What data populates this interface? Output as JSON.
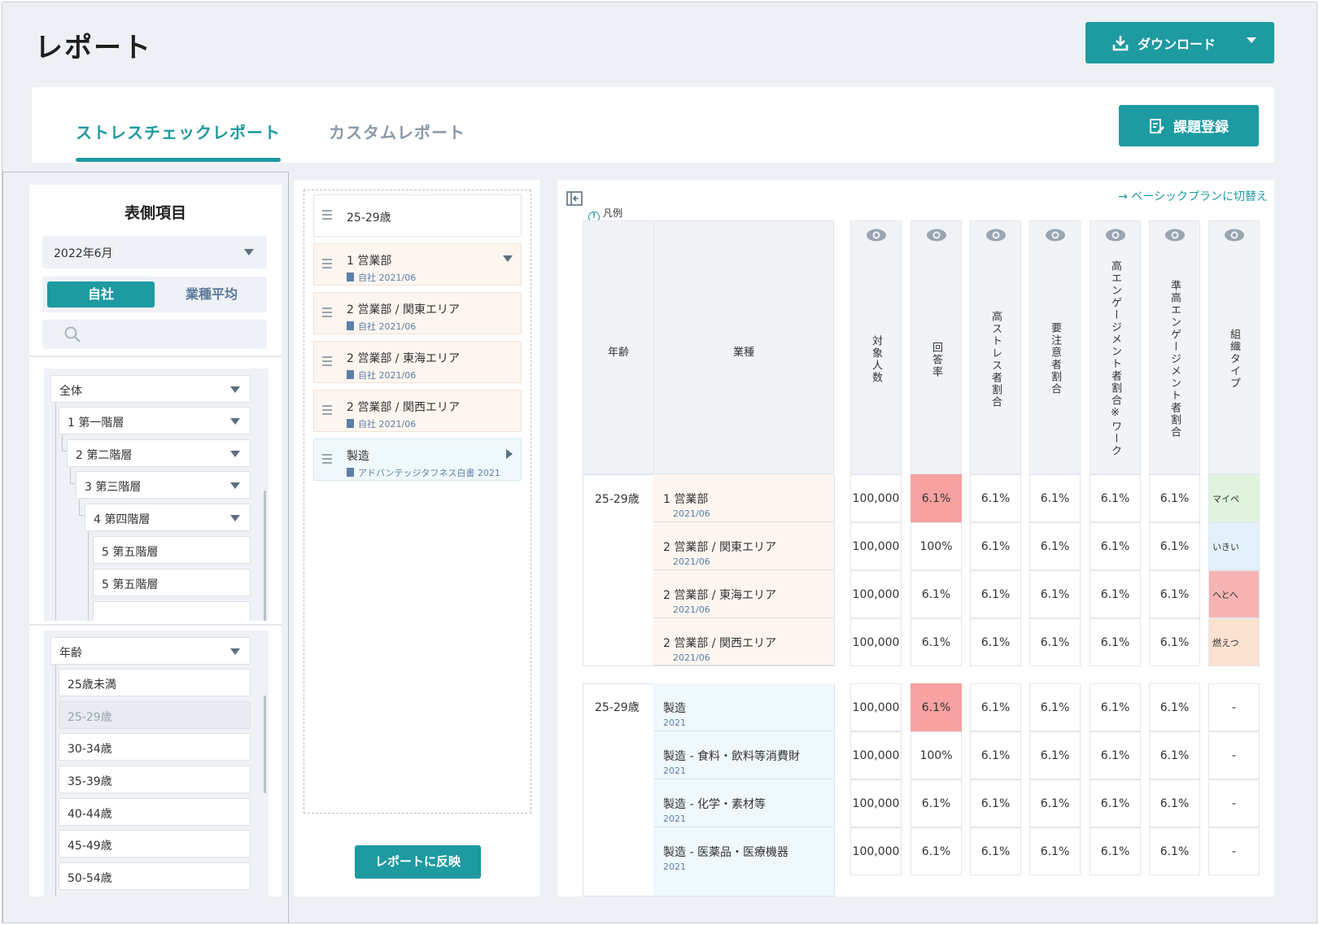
{
  "page": {
    "title": "レポート"
  },
  "header": {
    "download_label": "ダウンロード"
  },
  "tabs": [
    {
      "label": "ストレスチェックレポート",
      "active": true
    },
    {
      "label": "カスタムレポート",
      "active": false
    }
  ],
  "issue_button": "課題登録",
  "left_panel": {
    "title": "表側項目",
    "period": "2022年6月",
    "segment": {
      "on": "自社",
      "off": "業種平均"
    },
    "search_placeholder": "",
    "tree": [
      {
        "label": "全体",
        "level": 0
      },
      {
        "label": "1 第一階層",
        "level": 1
      },
      {
        "label": "2 第二階層",
        "level": 2
      },
      {
        "label": "3 第三階層",
        "level": 3
      },
      {
        "label": "4 第四階層",
        "level": 4
      },
      {
        "label": "5 第五階層",
        "level": 5
      },
      {
        "label": "5 第五階層",
        "level": 5
      }
    ],
    "age": {
      "header": "年齢",
      "items": [
        "25歳未満",
        "25-29歳",
        "30-34歳",
        "35-39歳",
        "40-44歳",
        "45-49歳",
        "50-54歳"
      ]
    }
  },
  "middle_panel": {
    "cards": [
      {
        "l1": "25-29歳",
        "l2": ""
      },
      {
        "l1": "1 営業部",
        "l2": "自社 2021/06"
      },
      {
        "l1": "2 営業部 / 関東エリア",
        "l2": "自社 2021/06"
      },
      {
        "l1": "2 営業部 / 東海エリア",
        "l2": "自社 2021/06"
      },
      {
        "l1": "2 営業部 / 関西エリア",
        "l2": "自社 2021/06"
      },
      {
        "l1": "製造",
        "l2": "アドバンテッジタフネス白書 2021"
      }
    ],
    "reflect_button": "レポートに反映"
  },
  "right_panel": {
    "switch_link": "→ ベーシックプランに切替え",
    "legend": "凡例",
    "columns": {
      "age": "年齢",
      "industry": "業種",
      "c1": "対象人数",
      "c2": "回答率",
      "c3": "高ストレス者割合",
      "c4": "要注意者割合",
      "c5": "高エンゲージメント者割合※ワーク",
      "c6": "準高エンゲージメント者割合",
      "c7": "組織タイプ"
    },
    "group1": {
      "age": "25-29歳",
      "rows": [
        {
          "name": "1 営業部",
          "sub": "2021/06",
          "c1": "100,000",
          "c2": "6.1%",
          "c3": "6.1%",
          "c4": "6.1%",
          "c5": "6.1%",
          "c6": "6.1%",
          "c7": "マイペ"
        },
        {
          "name": "2 営業部 / 関東エリア",
          "sub": "2021/06",
          "c1": "100,000",
          "c2": "100%",
          "c3": "6.1%",
          "c4": "6.1%",
          "c5": "6.1%",
          "c6": "6.1%",
          "c7": "いきい"
        },
        {
          "name": "2 営業部 / 東海エリア",
          "sub": "2021/06",
          "c1": "100,000",
          "c2": "6.1%",
          "c3": "6.1%",
          "c4": "6.1%",
          "c5": "6.1%",
          "c6": "6.1%",
          "c7": "へとへ"
        },
        {
          "name": "2 営業部 / 関西エリア",
          "sub": "2021/06",
          "c1": "100,000",
          "c2": "6.1%",
          "c3": "6.1%",
          "c4": "6.1%",
          "c5": "6.1%",
          "c6": "6.1%",
          "c7": "燃えつ"
        }
      ]
    },
    "group2": {
      "age": "25-29歳",
      "rows": [
        {
          "name": "製造",
          "sub": "2021",
          "c1": "100,000",
          "c2": "6.1%",
          "c3": "6.1%",
          "c4": "6.1%",
          "c5": "6.1%",
          "c6": "6.1%",
          "c7": "-"
        },
        {
          "name": "製造 - 食料・飲料等消費財",
          "sub": "2021",
          "c1": "100,000",
          "c2": "100%",
          "c3": "6.1%",
          "c4": "6.1%",
          "c5": "6.1%",
          "c6": "6.1%",
          "c7": "-"
        },
        {
          "name": "製造 - 化学・素材等",
          "sub": "2021",
          "c1": "100,000",
          "c2": "6.1%",
          "c3": "6.1%",
          "c4": "6.1%",
          "c5": "6.1%",
          "c6": "6.1%",
          "c7": "-"
        },
        {
          "name": "製造 - 医薬品・医療機器",
          "sub": "2021",
          "c1": "100,000",
          "c2": "6.1%",
          "c3": "6.1%",
          "c4": "6.1%",
          "c5": "6.1%",
          "c6": "6.1%",
          "c7": "-"
        }
      ]
    }
  },
  "colors": {
    "accent": "#1e9aa1",
    "alert": "#f7a1a1"
  }
}
